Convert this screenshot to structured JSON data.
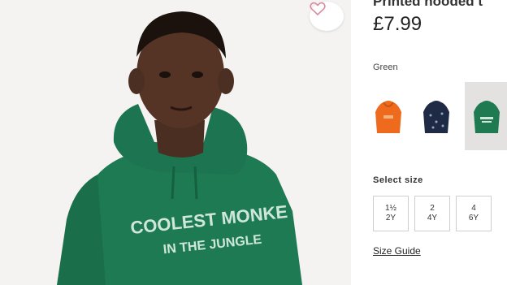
{
  "product": {
    "title": "Printed hooded t",
    "price": "£7.99",
    "photo_text_line1": "COOLEST MONKE",
    "photo_text_line2": "IN THE JUNGLE"
  },
  "color": {
    "selected_label": "Green",
    "swatches": [
      {
        "name": "orange",
        "hex": "#ee6a1d"
      },
      {
        "name": "navy",
        "hex": "#1f2a44"
      },
      {
        "name": "green",
        "hex": "#1f7a52"
      }
    ]
  },
  "size": {
    "label": "Select size",
    "options": [
      {
        "line1": "1½",
        "line2": "2Y"
      },
      {
        "line1": "2",
        "line2": "4Y"
      },
      {
        "line1": "4",
        "line2": "6Y"
      }
    ],
    "guide_label": "Size Guide"
  },
  "icons": {
    "favorite": "heart-icon"
  }
}
